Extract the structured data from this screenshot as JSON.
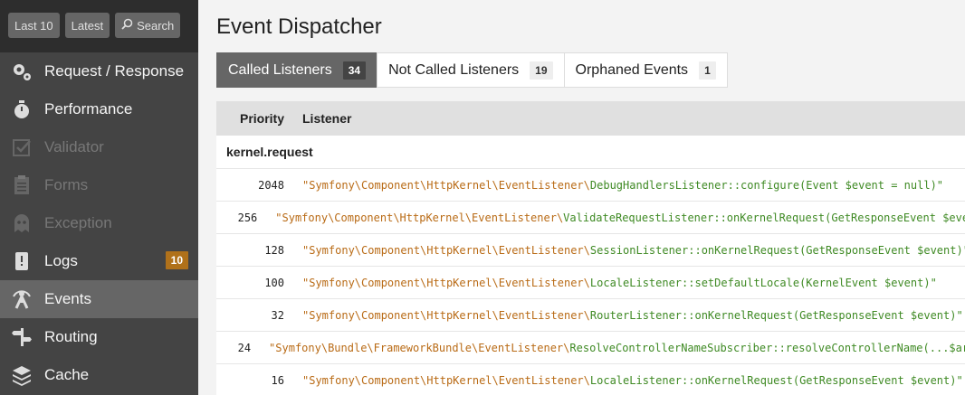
{
  "sidebar": {
    "top_buttons": [
      {
        "label": "Last 10"
      },
      {
        "label": "Latest"
      },
      {
        "label": "Search"
      }
    ],
    "items": [
      {
        "label": "Request / Response",
        "icon": "gears-icon",
        "state": "normal"
      },
      {
        "label": "Performance",
        "icon": "stopwatch-icon",
        "state": "normal"
      },
      {
        "label": "Validator",
        "icon": "check-icon",
        "state": "disabled"
      },
      {
        "label": "Forms",
        "icon": "clipboard-icon",
        "state": "disabled"
      },
      {
        "label": "Exception",
        "icon": "ghost-icon",
        "state": "disabled"
      },
      {
        "label": "Logs",
        "icon": "book-icon",
        "state": "normal",
        "badge": "10"
      },
      {
        "label": "Events",
        "icon": "events-icon",
        "state": "selected"
      },
      {
        "label": "Routing",
        "icon": "signpost-icon",
        "state": "normal"
      },
      {
        "label": "Cache",
        "icon": "database-icon",
        "state": "normal"
      }
    ],
    "badge_color": "#b0711a"
  },
  "main": {
    "title": "Event Dispatcher",
    "tabs": [
      {
        "label": "Called Listeners",
        "count": "34",
        "active": true
      },
      {
        "label": "Not Called Listeners",
        "count": "19",
        "active": false
      },
      {
        "label": "Orphaned Events",
        "count": "1",
        "active": false
      }
    ],
    "table": {
      "headers": {
        "priority": "Priority",
        "listener": "Listener"
      },
      "group": "kernel.request",
      "rows": [
        {
          "priority": "2048",
          "ns": "\"Symfony\\Component\\HttpKernel\\EventListener\\",
          "fn": "DebugHandlersListener::configure(Event $event = null)\""
        },
        {
          "priority": "256",
          "ns": "\"Symfony\\Component\\HttpKernel\\EventListener\\",
          "fn": "ValidateRequestListener::onKernelRequest(GetResponseEvent $event)\""
        },
        {
          "priority": "128",
          "ns": "\"Symfony\\Component\\HttpKernel\\EventListener\\",
          "fn": "SessionListener::onKernelRequest(GetResponseEvent $event)\""
        },
        {
          "priority": "100",
          "ns": "\"Symfony\\Component\\HttpKernel\\EventListener\\",
          "fn": "LocaleListener::setDefaultLocale(KernelEvent $event)\""
        },
        {
          "priority": "32",
          "ns": "\"Symfony\\Component\\HttpKernel\\EventListener\\",
          "fn": "RouterListener::onKernelRequest(GetResponseEvent $event)\""
        },
        {
          "priority": "24",
          "ns": "\"Symfony\\Bundle\\FrameworkBundle\\EventListener\\",
          "fn": "ResolveControllerNameSubscriber::resolveControllerName(...$args)\""
        },
        {
          "priority": "16",
          "ns": "\"Symfony\\Component\\HttpKernel\\EventListener\\",
          "fn": "LocaleListener::onKernelRequest(GetResponseEvent $event)\""
        }
      ]
    }
  }
}
